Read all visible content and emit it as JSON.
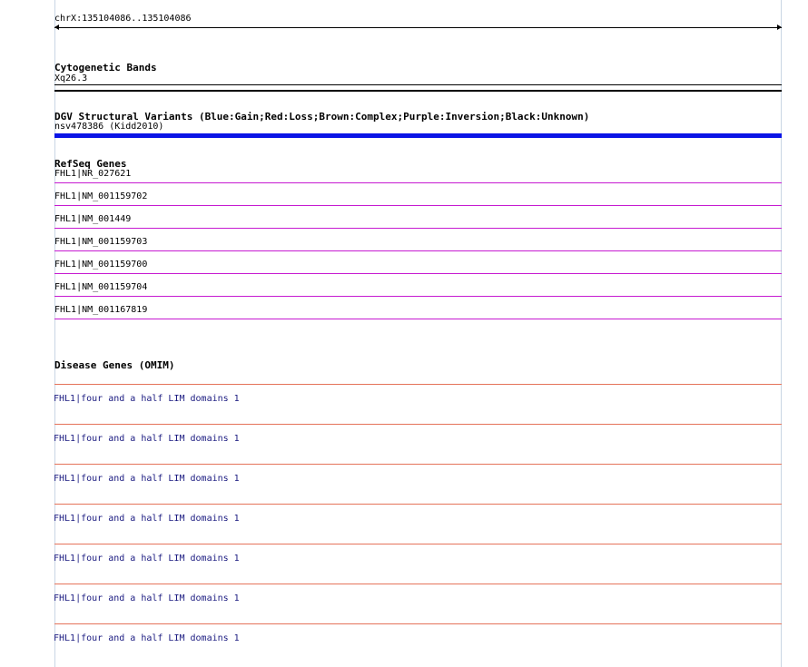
{
  "colors": {
    "frame": "#c9d6e4",
    "dgv_bar": "#0a14e6",
    "refseq": "#c61ad1",
    "omim": "#e5735a",
    "omim_text": "#1a1a80"
  },
  "ruler": {
    "label": "chrX:135104086..135104086"
  },
  "cytobands": {
    "title": "Cytogenetic Bands",
    "band": "Xq26.3"
  },
  "dgv": {
    "title": "DGV Structural Variants (Blue:Gain;Red:Loss;Brown:Complex;Purple:Inversion;Black:Unknown)",
    "feature": "nsv478386 (Kidd2010)"
  },
  "refseq": {
    "title": "RefSeq Genes",
    "features": [
      "FHL1|NR_027621",
      "FHL1|NM_001159702",
      "FHL1|NM_001449",
      "FHL1|NM_001159703",
      "FHL1|NM_001159700",
      "FHL1|NM_001159704",
      "FHL1|NM_001167819"
    ]
  },
  "omim": {
    "title": "Disease Genes (OMIM)",
    "features": [
      "FHL1|four and a half LIM domains 1",
      "FHL1|four and a half LIM domains 1",
      "FHL1|four and a half LIM domains 1",
      "FHL1|four and a half LIM domains 1",
      "FHL1|four and a half LIM domains 1",
      "FHL1|four and a half LIM domains 1",
      "FHL1|four and a half LIM domains 1"
    ]
  }
}
